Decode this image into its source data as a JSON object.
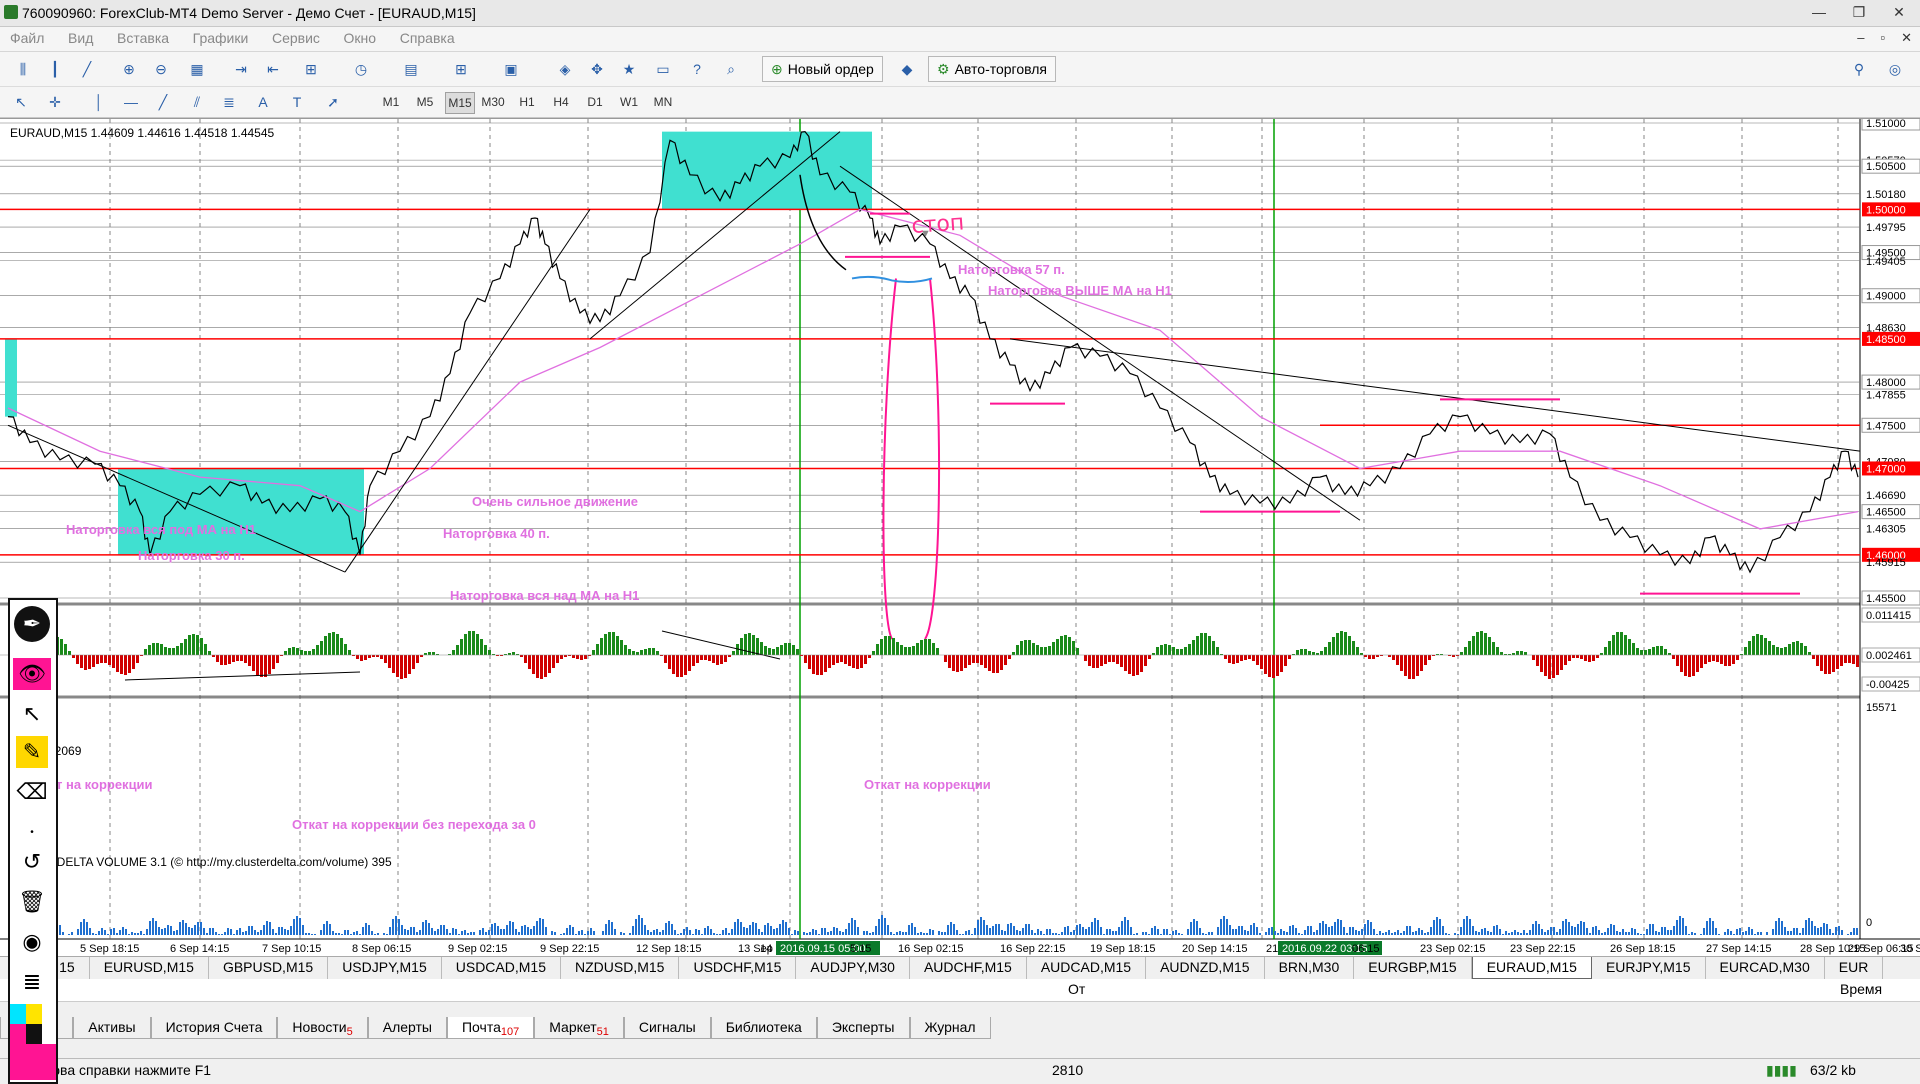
{
  "window": {
    "title": "760090960: ForexClub-MT4 Demo Server - Демо Счет - [EURAUD,M15]"
  },
  "menu": [
    "Файл",
    "Вид",
    "Вставка",
    "Графики",
    "Сервис",
    "Окно",
    "Справка"
  ],
  "toolbar": {
    "new_order": "Новый ордер",
    "auto_trading": "Авто-торговля"
  },
  "timeframes": [
    "M1",
    "M5",
    "M15",
    "M30",
    "H1",
    "H4",
    "D1",
    "W1",
    "MN"
  ],
  "active_timeframe": "M15",
  "chart": {
    "header": "EURAUD,M15  1.44609 1.44616 1.44518 1.44545",
    "price_axis": [
      "1.51000",
      "1.50570",
      "1.50500",
      "1.50180",
      "1.50000",
      "1.49795",
      "1.49500",
      "1.49405",
      "1.49000",
      "1.48630",
      "1.48500",
      "1.48000",
      "1.47855",
      "1.47500",
      "1.47080",
      "1.47000",
      "1.46690",
      "1.46500",
      "1.46305",
      "1.46000",
      "1.45915",
      "1.45500"
    ],
    "highlighted_levels": [
      "1.50000",
      "1.48500",
      "1.47000",
      "1.46000"
    ],
    "bordered_levels": [
      "1.51000",
      "1.50500",
      "1.49500",
      "1.49000",
      "1.48000",
      "1.47500",
      "1.46500",
      "1.45500"
    ],
    "time_axis": [
      "5 Sep 18:15",
      "6 Sep 14:15",
      "7 Sep 10:15",
      "8 Sep 06:15",
      "9 Sep 02:15",
      "9 Sep 22:15",
      "12 Sep 18:15",
      "13 Sep 14:15",
      "14",
      "2016.09.15 05:00",
      "5:15",
      "16 Sep 02:15",
      "16 Sep 22:15",
      "19 Sep 18:15",
      "20 Sep 14:15",
      "21",
      "2016.09.22 03:15",
      "06:15",
      "23 Sep 02:15",
      "23 Sep 22:15",
      "26 Sep 18:15",
      "27 Sep 14:15",
      "28 Sep 10:15",
      "29 Sep 06:15",
      "30 Sep 02:15"
    ],
    "time_axis_first": "5",
    "annotations": {
      "stop": "стоп",
      "nat57": "Наторговка 57 п.",
      "nat_above_h1": "Наторговка ВЫШЕ МА на Н1",
      "strong_move": "Очень сильное движение",
      "nat_all_under": "Наторговка вся под МА на Н1",
      "nat40": "Наторговка 40 п.",
      "nat30": "Наторговка 30 п.",
      "nat_all_above": "Наторговка вся над МА на Н1",
      "pullback1": "т на коррекции",
      "pullback2": "Откат на коррекции",
      "pullback_no_cross": "Откат на коррекции без перехода за 0"
    },
    "delta_label": "02069",
    "delta_axis": [
      "0.011415",
      "0.002461",
      "-0.00425"
    ],
    "volume_label": "RDELTA VOLUME 3.1 (© http://my.clusterdelta.com/volume) 395",
    "volume_axis": [
      "15571",
      "0"
    ]
  },
  "symbol_tabs": [
    "USD,M15",
    "EURUSD,M15",
    "GBPUSD,M15",
    "USDJPY,M15",
    "USDCAD,M15",
    "NZDUSD,M15",
    "USDCHF,M15",
    "AUDJPY,M30",
    "AUDCHF,M15",
    "AUDCAD,M15",
    "AUDNZD,M15",
    "BRN,M30",
    "EURGBP,M15",
    "EURAUD,M15",
    "EURJPY,M15",
    "EURCAD,M30",
    "EUR"
  ],
  "active_symbol_tab": "EURAUD,M15",
  "terminal": {
    "col_from": "От",
    "col_time": "Время",
    "col_left": "а",
    "tabs": [
      {
        "label": "рговля",
        "badge": ""
      },
      {
        "label": "Активы",
        "badge": ""
      },
      {
        "label": "История Счета",
        "badge": ""
      },
      {
        "label": "Новости",
        "badge": "5"
      },
      {
        "label": "Алерты",
        "badge": ""
      },
      {
        "label": "Почта",
        "badge": "107"
      },
      {
        "label": "Маркет",
        "badge": "51"
      },
      {
        "label": "Сигналы",
        "badge": ""
      },
      {
        "label": "Библиотека",
        "badge": ""
      },
      {
        "label": "Эксперты",
        "badge": ""
      },
      {
        "label": "Журнал",
        "badge": ""
      }
    ],
    "active_tab": "Почта"
  },
  "status": {
    "help": "зова справки нажмите F1",
    "value": "2810",
    "traffic": "63/2 kb"
  },
  "colors": {
    "level_red": "#ff0000",
    "zone_cyan": "#40e0d0",
    "ma_magenta": "#e070e0",
    "annotation_pink": "#e040a0",
    "period_green": "#00a000"
  }
}
